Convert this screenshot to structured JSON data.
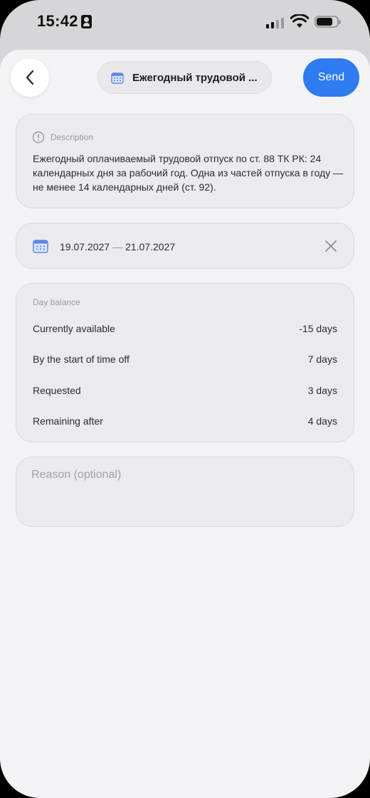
{
  "status_bar": {
    "time": "15:42"
  },
  "header": {
    "back_icon": "chevron-left-icon",
    "leave_type": "Ежегодный трудовой ...",
    "send_label": "Send",
    "accent_color": "#2f7bf0"
  },
  "description": {
    "title": "Description",
    "text": "Ежегодный оплачиваемый трудовой отпуск по ст. 88 ТК РК: 24 календарных дня за рабочий год. Одна из частей отпуска в году — не менее 14 календарных дней (ст. 92)."
  },
  "dates": {
    "start": "19.07.2027",
    "separator": "—",
    "end": "21.07.2027"
  },
  "balance": {
    "title": "Day balance",
    "rows": [
      {
        "label": "Currently available",
        "value": "-15 days"
      },
      {
        "label": "By the start of time off",
        "value": "7 days"
      },
      {
        "label": "Requested",
        "value": "3 days"
      },
      {
        "label": "Remaining after",
        "value": "4 days"
      }
    ]
  },
  "reason": {
    "placeholder": "Reason (optional)",
    "value": ""
  }
}
